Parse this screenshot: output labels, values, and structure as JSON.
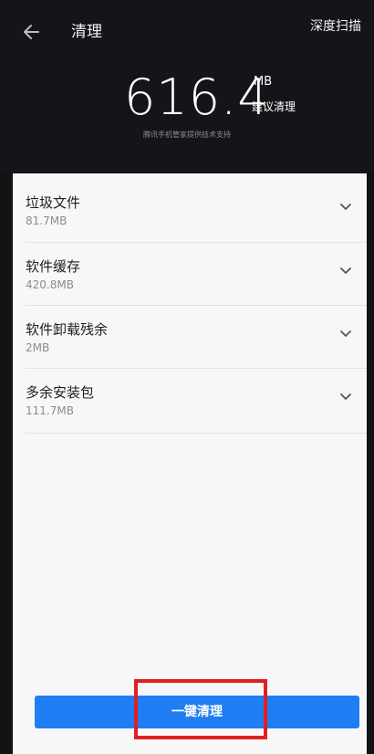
{
  "header": {
    "title": "清理",
    "deep_scan_label": "深度扫描"
  },
  "summary": {
    "size_value": "616.4",
    "size_unit": "MB",
    "suggest_label": "建议清理",
    "provider_text": "腾讯手机管家提供技术支持"
  },
  "items": [
    {
      "title": "垃圾文件",
      "size": "81.7MB"
    },
    {
      "title": "软件缓存",
      "size": "420.8MB"
    },
    {
      "title": "软件卸载残余",
      "size": "2MB"
    },
    {
      "title": "多余安装包",
      "size": "111.7MB"
    }
  ],
  "actions": {
    "clean_label": "一键清理"
  },
  "colors": {
    "accent": "#1f7ef3",
    "highlight": "#e02020",
    "header_bg": "#141518",
    "content_bg": "#f7f7f7"
  },
  "icons": {
    "back": "back-arrow-icon",
    "expand": "chevron-down-icon"
  }
}
